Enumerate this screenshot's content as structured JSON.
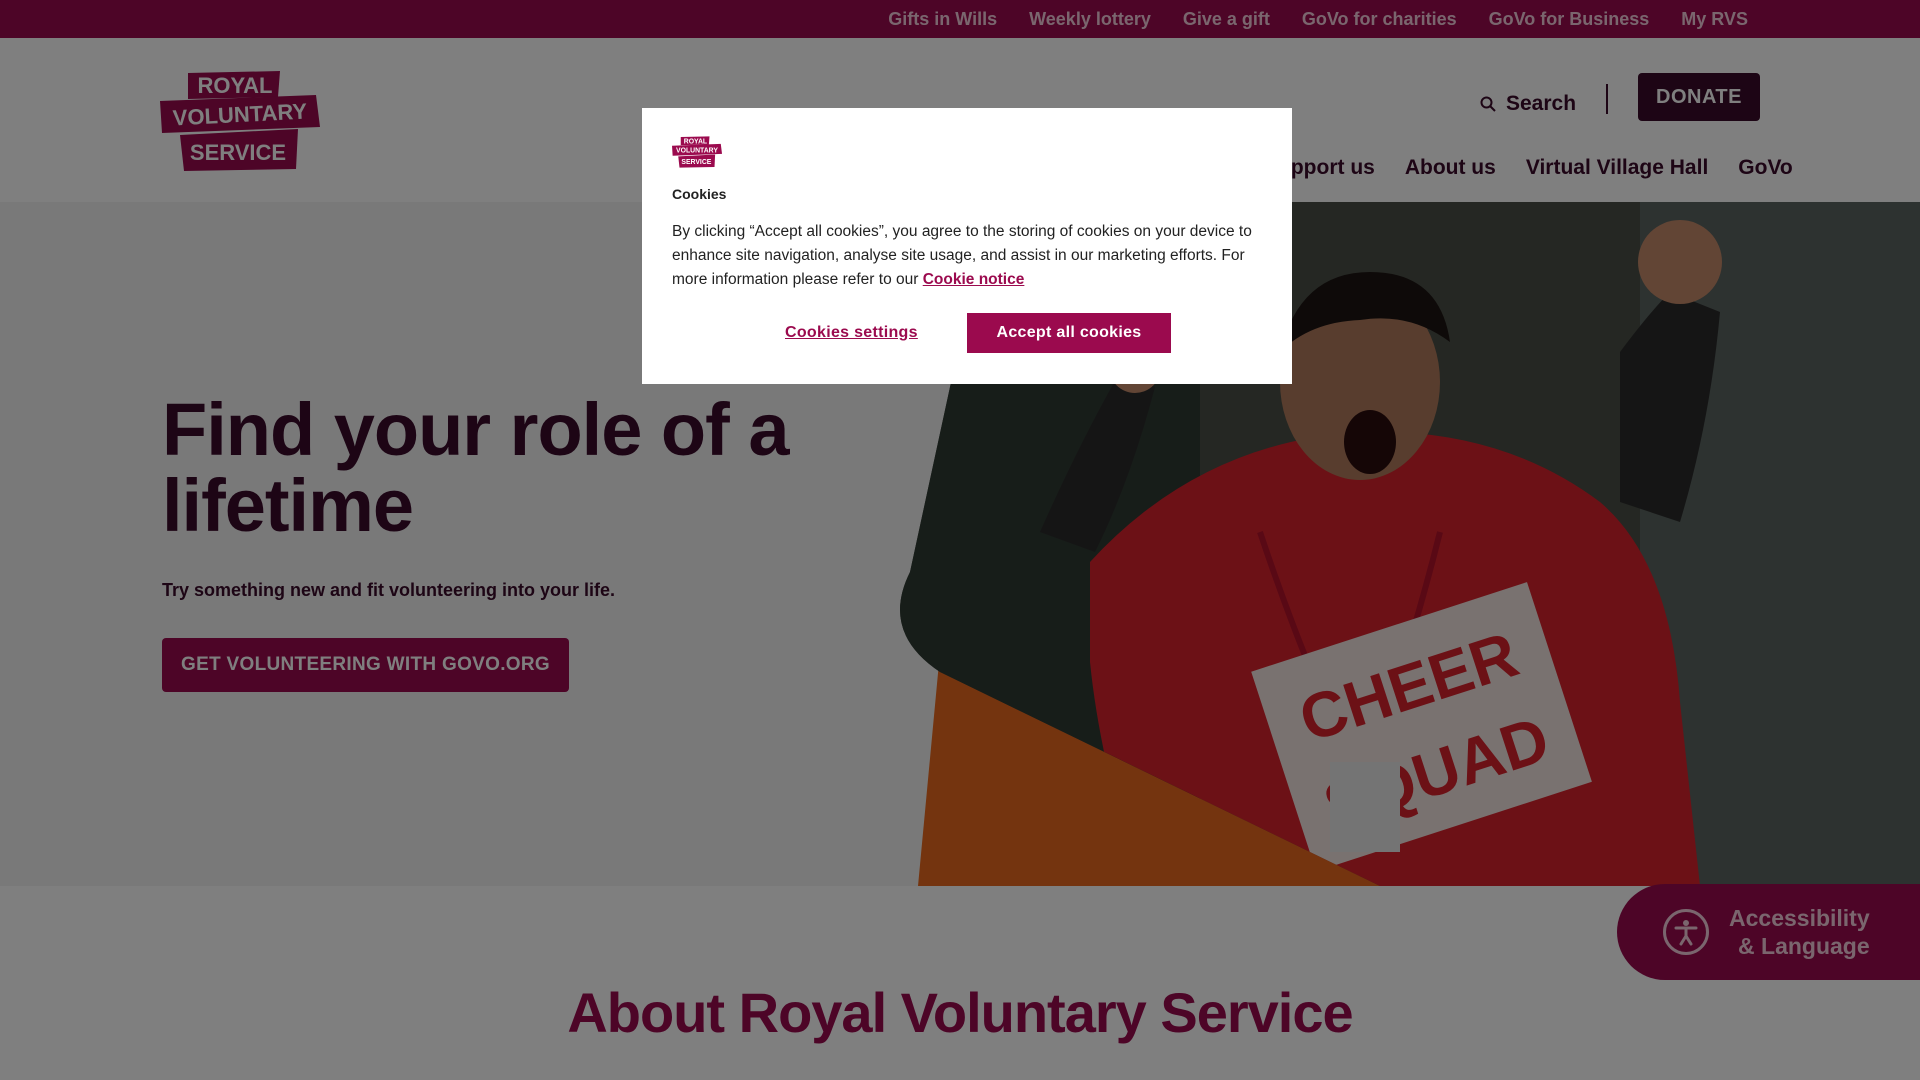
{
  "topbar": {
    "links": [
      "Gifts in Wills",
      "Weekly lottery",
      "Give a gift",
      "GoVo for charities",
      "GoVo for Business",
      "My RVS"
    ]
  },
  "header": {
    "logo_text": [
      "ROYAL",
      "VOLUNTARY",
      "SERVICE"
    ],
    "search_label": "Search",
    "donate_label": "DONATE",
    "nav": [
      "Support us",
      "About us",
      "Virtual Village Hall",
      "GoVo"
    ]
  },
  "hero": {
    "title": "Find your role of a lifetime",
    "subtitle": "Try something new and fit volunteering into your life.",
    "cta_label": "GET VOLUNTEERING WITH GOVO.ORG",
    "photo_shirt_text": [
      "CHEER",
      "SQUAD"
    ]
  },
  "about": {
    "title": "About Royal Voluntary Service"
  },
  "accessibility": {
    "line1": "Accessibility",
    "line2": "& Language"
  },
  "cookie_dialog": {
    "title": "Cookies",
    "body": "By clicking “Accept all cookies”, you agree to the storing of cookies on your device to enhance site navigation, analyse site usage, and assist in our marketing efforts. For more information please refer to our",
    "notice_link": "Cookie notice",
    "settings_label": "Cookies settings",
    "accept_label": "Accept all cookies"
  },
  "colors": {
    "brand_magenta": "#9b0a4e",
    "brand_plum": "#3b0a2a",
    "accent_orange": "#e8681e",
    "shirt_red": "#d9232c"
  }
}
